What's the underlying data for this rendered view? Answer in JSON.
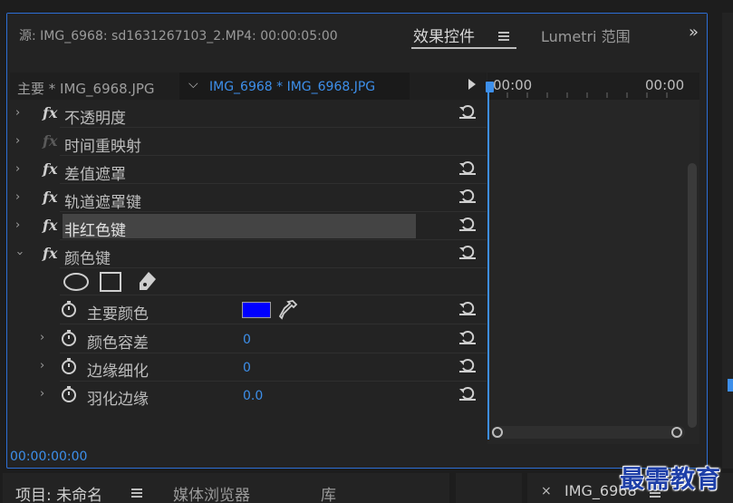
{
  "header": {
    "source": "源: IMG_6968: sd1631267103_2.MP4: 00:00:05:00",
    "effects_tab": "效果控件",
    "lumetri_tab": "Lumetri 范围",
    "more": "»"
  },
  "source_row": {
    "master": "主要 * IMG_6968.JPG",
    "clip": "IMG_6968 * IMG_6968.JPG"
  },
  "effects": [
    {
      "label": "不透明度",
      "fx_dim": false
    },
    {
      "label": "时间重映射",
      "fx_dim": true
    },
    {
      "label": "差值遮罩",
      "fx_dim": false
    },
    {
      "label": "轨道遮罩键",
      "fx_dim": false
    },
    {
      "label": "非红色键",
      "fx_dim": false
    },
    {
      "label": "颜色键",
      "fx_dim": false
    }
  ],
  "properties": [
    {
      "label": "主要颜色",
      "value": ""
    },
    {
      "label": "颜色容差",
      "value": "0"
    },
    {
      "label": "边缘细化",
      "value": "0"
    },
    {
      "label": "羽化边缘",
      "value": "0.0"
    }
  ],
  "key_color": "#0000ff",
  "timeline": {
    "start": "00:00",
    "end": "00:00"
  },
  "footer_time": "00:00:00:00",
  "bottom": {
    "project": "项目: 未命名",
    "media": "媒体浏览器",
    "library": "库",
    "close": "×",
    "sequence": "IMG_6968"
  },
  "watermark": "最需教育"
}
